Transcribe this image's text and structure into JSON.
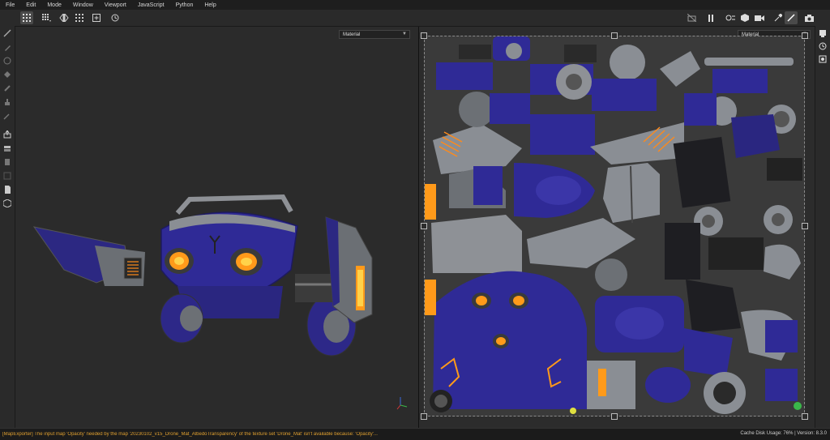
{
  "menu": {
    "items": [
      "File",
      "Edit",
      "Mode",
      "Window",
      "Viewport",
      "JavaScript",
      "Python",
      "Help"
    ]
  },
  "toolbar": {
    "left_icons": [
      "grid-layout-icon",
      "grid-split-icon",
      "symmetry-icon",
      "grid-small-icon",
      "add-view-icon",
      "history-icon"
    ],
    "right_icons": [
      "camera-off-icon",
      "pause-icon",
      "render-icon",
      "cube-icon",
      "camera-icon",
      "eyedropper-icon",
      "brush-icon",
      "screenshot-icon"
    ]
  },
  "viewport3d": {
    "display_mode": "Material"
  },
  "viewport2d": {
    "display_mode": "Material"
  },
  "status": {
    "message": "[MapExporter] The input map 'Opacity' needed by the map '20230102_v15_Drone_Mat_AlbedoTransparency' of the texture set 'Drone_Mat' isn't available because: 'Opacity'...",
    "cache_label": "Cache Disk Usage:",
    "cache_value": "76%",
    "version": "| Version: 8.3.0"
  },
  "colors": {
    "accent_blue": "#3a2f9a",
    "metal": "#8a8e94",
    "glow": "#ff9a1a",
    "warning_text": "#e0a030"
  }
}
